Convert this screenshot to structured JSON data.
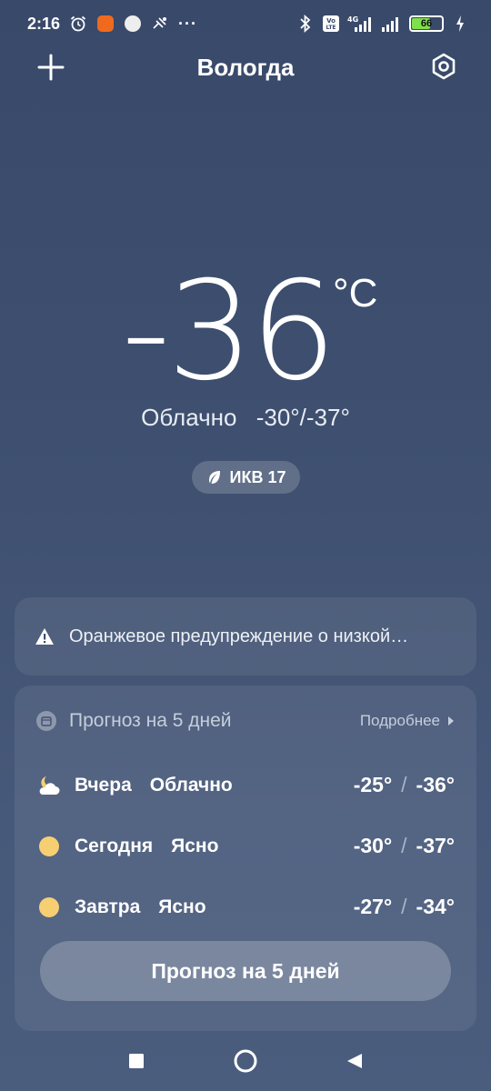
{
  "status": {
    "time": "2:16",
    "network": "4G",
    "battery": "66"
  },
  "header": {
    "city": "Вологда"
  },
  "current": {
    "temp": "-36",
    "unit": "°C",
    "condition": "Облачно",
    "range": "-30°/-37°",
    "aqi": "ИКВ 17"
  },
  "alert": {
    "text": "Оранжевое предупреждение о низкой…"
  },
  "forecast": {
    "title": "Прогноз на 5 дней",
    "more": "Подробнее",
    "days": [
      {
        "day": "Вчера",
        "condition": "Облачно",
        "high": "-25°",
        "low": "-36°",
        "icon": "partly-cloudy-night-icon"
      },
      {
        "day": "Сегодня",
        "condition": "Ясно",
        "high": "-30°",
        "low": "-37°",
        "icon": "sun-icon"
      },
      {
        "day": "Завтра",
        "condition": "Ясно",
        "high": "-27°",
        "low": "-34°",
        "icon": "sun-icon"
      }
    ],
    "button": "Прогноз на 5 дней"
  },
  "colors": {
    "sun": "#f6cf72",
    "background_top": "#39496a",
    "background_bottom": "#4b5d7d"
  }
}
